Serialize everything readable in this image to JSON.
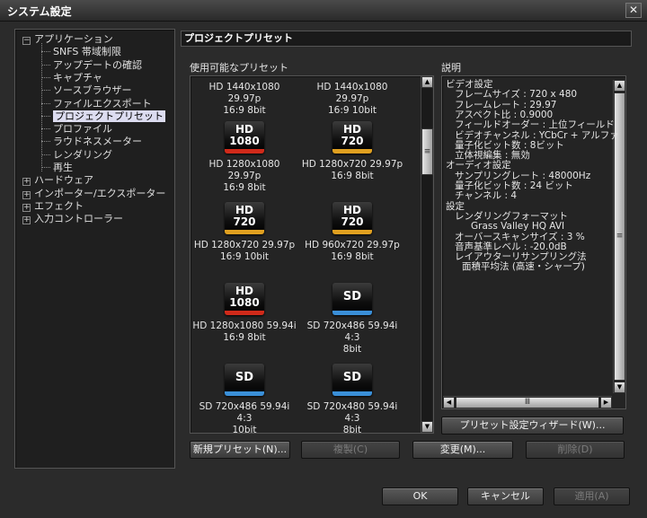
{
  "window": {
    "title": "システム設定",
    "close_glyph": "✕"
  },
  "tree": {
    "items": [
      {
        "label": "アプリケーション",
        "expander": "−"
      },
      {
        "label": "SNFS 帯域制限"
      },
      {
        "label": "アップデートの確認"
      },
      {
        "label": "キャプチャ"
      },
      {
        "label": "ソースブラウザー"
      },
      {
        "label": "ファイルエクスポート"
      },
      {
        "label": "プロジェクトプリセット",
        "selected": true
      },
      {
        "label": "プロファイル"
      },
      {
        "label": "ラウドネスメーター"
      },
      {
        "label": "レンダリング"
      },
      {
        "label": "再生"
      },
      {
        "label": "ハードウェア",
        "expander": "+"
      },
      {
        "label": "インポーター/エクスポーター",
        "expander": "+"
      },
      {
        "label": "エフェクト",
        "expander": "+"
      },
      {
        "label": "入力コントローラー",
        "expander": "+"
      }
    ]
  },
  "panel": {
    "header": "プロジェクトプリセット",
    "presets_label": "使用可能なプリセット",
    "description_label": "説明"
  },
  "presets": [
    {
      "line1": "HD 1440x1080 29.97p",
      "line2": "16:9 8bit",
      "badge": null
    },
    {
      "line1": "HD 1440x1080 29.97p",
      "line2": "16:9 10bit",
      "badge": null
    },
    {
      "line1": "HD 1280x1080 29.97p",
      "line2": "16:9 8bit",
      "badge": {
        "top": "HD",
        "bottom": "1080",
        "color": "red"
      }
    },
    {
      "line1": "HD 1280x720 29.97p",
      "line2": "16:9 8bit",
      "badge": {
        "top": "HD",
        "bottom": "720",
        "color": "gold"
      }
    },
    {
      "line1": "HD 1280x720 29.97p",
      "line2": "16:9 10bit",
      "badge": {
        "top": "HD",
        "bottom": "720",
        "color": "gold"
      }
    },
    {
      "line1": "HD 960x720 29.97p",
      "line2": "16:9 8bit",
      "badge": {
        "top": "HD",
        "bottom": "720",
        "color": "gold"
      }
    },
    {
      "line1": "HD 1280x1080 59.94i",
      "line2": "16:9 8bit",
      "badge": {
        "top": "HD",
        "bottom": "1080",
        "color": "red"
      }
    },
    {
      "line1": "SD 720x486 59.94i 4:3",
      "line2": "8bit",
      "badge": {
        "top": "SD",
        "bottom": "",
        "color": "blue"
      }
    },
    {
      "line1": "SD 720x486 59.94i 4:3",
      "line2": "10bit",
      "badge": {
        "top": "SD",
        "bottom": "",
        "color": "blue"
      }
    },
    {
      "line1": "SD 720x480 59.94i 4:3",
      "line2": "8bit",
      "badge": {
        "top": "SD",
        "bottom": "",
        "color": "blue"
      }
    }
  ],
  "description": {
    "lines": [
      "ビデオ設定",
      "フレームサイズ : 720 x 480",
      "フレームレート : 29.97",
      "アスペクト比 : 0.9000",
      "フィールドオーダー : 上位フィールド",
      "ビデオチャンネル : YCbCr + アルファ",
      "量子化ビット数 : 8ビット",
      "立体視編集 : 無効",
      "オーディオ設定",
      "サンプリングレート : 48000Hz",
      "量子化ビット数 : 24 ビット",
      "チャンネル : 4",
      "設定",
      "レンダリングフォーマット",
      "Grass Valley HQ AVI",
      "オーバースキャンサイズ : 3 %",
      "音声基準レベル : -20.0dB",
      "レイアウターリサンプリング法",
      "面積平均法 (高速・シャープ)"
    ]
  },
  "buttons": {
    "wizard": "プリセット設定ウィザード(W)...",
    "new_preset": "新規プリセット(N)...",
    "duplicate": "複製(C)",
    "modify": "変更(M)...",
    "delete": "削除(D)",
    "ok": "OK",
    "cancel": "キャンセル",
    "apply": "適用(A)"
  },
  "scroll_glyphs": {
    "up": "▲",
    "down": "▼",
    "left": "◀",
    "right": "▶",
    "grip_v": "≡",
    "grip_h": "Ⅲ"
  },
  "colors": {
    "badge_red": "#d02a1a",
    "badge_gold": "#e0a020",
    "badge_blue": "#3a8fd8",
    "selection": "#dcdcf0"
  }
}
